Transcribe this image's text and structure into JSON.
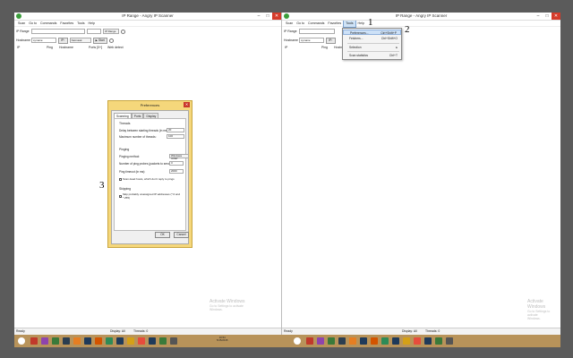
{
  "left_window": {
    "title": "IP Range - Angry IP Scanner",
    "menu": [
      "Scan",
      "Go to",
      "Commands",
      "Favorites",
      "Tools",
      "Help"
    ],
    "ip_range_label": "IP Range",
    "range_mode": "IP Range",
    "hostname_label": "Hostname",
    "hostname_value": "symane",
    "ip_button": "IP↑",
    "netmask": "Netmask",
    "start_button": "▶ Start",
    "columns": [
      "IP",
      "Ping",
      "Hostname",
      "Ports [0+]",
      "Web detect"
    ],
    "status": {
      "ready": "Ready",
      "display": "Display: All",
      "threads": "Threads: 0"
    },
    "watermark_title": "Activate Windows",
    "watermark_sub": [
      "Go to Settings to activate",
      "Windows."
    ]
  },
  "right_window": {
    "title": "IP Range - Angry IP Scanner",
    "menu": [
      "Scan",
      "Go to",
      "Commands",
      "Favorites",
      "Tools",
      "Help"
    ],
    "active_menu": "Tools",
    "ip_range_label": "IP Range",
    "hostname_label": "Hostname",
    "hostname_value": "symane",
    "ip_button": "IP↑",
    "columns": [
      "IP",
      "Ping",
      "Hostname",
      "Ports [0+]",
      "Web detect"
    ],
    "status": {
      "ready": "Ready",
      "display": "Display: All",
      "threads": "Threads: 0"
    },
    "watermark_title": "Activate Windows",
    "watermark_sub": [
      "Go to Settings to activate",
      "Windows."
    ]
  },
  "tools_menu": {
    "items": [
      {
        "label": "Preferences...",
        "shortcut": "Ctrl+Shift+P"
      },
      {
        "label": "Fetchers...",
        "shortcut": "Ctrl+Shift+O"
      },
      {
        "label": "Selection",
        "shortcut": "▸"
      },
      {
        "label": "Scan statistics",
        "shortcut": "Ctrl+T"
      }
    ]
  },
  "annotations": [
    "1",
    "2",
    "3"
  ],
  "preferences": {
    "title": "Preferences",
    "close": "✕",
    "tabs": [
      "Scanning",
      "Ports",
      "Display"
    ],
    "threads_group": "Threads",
    "delay_label": "Delay between starting threads (in ms):",
    "delay_value": "20",
    "max_threads_label": "Maximum number of threads:",
    "max_threads_value": "100",
    "pinging_group": "Pinging",
    "ping_method_label": "Pinging method:",
    "ping_method_value": "Windows ICMP",
    "ping_probes_label": "Number of ping probes (packets to send):",
    "ping_probes_value": "3",
    "ping_timeout_label": "Ping timeout (in ms):",
    "ping_timeout_value": "2000",
    "scan_dead_label": "Scan dead hosts, which don't reply to pings",
    "skipping_group": "Skipping",
    "skip_label": "Skip probably unassigned IP addresses (*.0 and *.255)",
    "ok": "OK",
    "cancel": "Cancel"
  },
  "taskbar": {
    "time": "10:54",
    "date": "5/15/2015"
  }
}
